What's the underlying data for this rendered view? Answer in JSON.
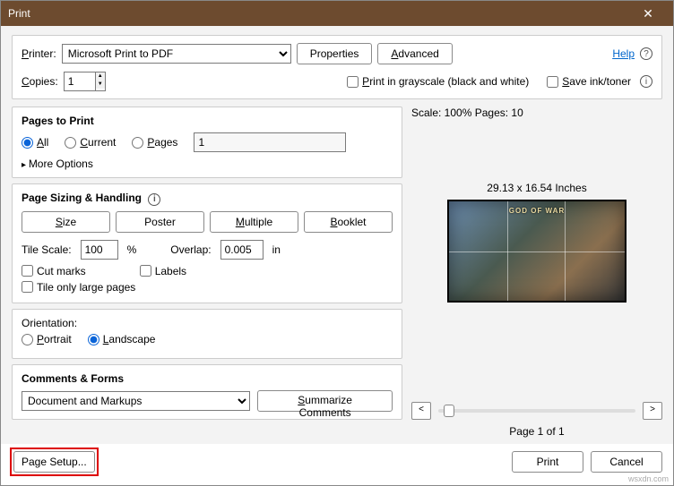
{
  "window": {
    "title": "Print"
  },
  "top": {
    "printer_label": "Printer:",
    "printer_value": "Microsoft Print to PDF",
    "properties": "Properties",
    "advanced": "Advanced",
    "help": "Help",
    "copies_label": "Copies:",
    "copies_value": "1",
    "grayscale": "Print in grayscale (black and white)",
    "saveink": "Save ink/toner"
  },
  "pages": {
    "title": "Pages to Print",
    "all": "All",
    "current": "Current",
    "pages": "Pages",
    "pages_value": "1",
    "more": "More Options"
  },
  "sizing": {
    "title": "Page Sizing & Handling",
    "size": "Size",
    "poster": "Poster",
    "multiple": "Multiple",
    "booklet": "Booklet",
    "tilescale_label": "Tile Scale:",
    "tilescale_value": "100",
    "tilescale_unit": "%",
    "overlap_label": "Overlap:",
    "overlap_value": "0.005",
    "overlap_unit": "in",
    "cutmarks": "Cut marks",
    "labels": "Labels",
    "tilelarge": "Tile only large pages"
  },
  "orientation": {
    "title": "Orientation:",
    "portrait": "Portrait",
    "landscape": "Landscape"
  },
  "comments": {
    "title": "Comments & Forms",
    "value": "Document and Markups",
    "summarize": "Summarize Comments"
  },
  "preview": {
    "scale": "Scale: 100% Pages: 10",
    "dims": "29.13 x 16.54 Inches",
    "logo": "GOD OF WAR",
    "pageinfo": "Page 1 of 1",
    "prev": "<",
    "next": ">"
  },
  "footer": {
    "pagesetup": "Page Setup...",
    "print": "Print",
    "cancel": "Cancel"
  },
  "watermark": "wsxdn.com"
}
